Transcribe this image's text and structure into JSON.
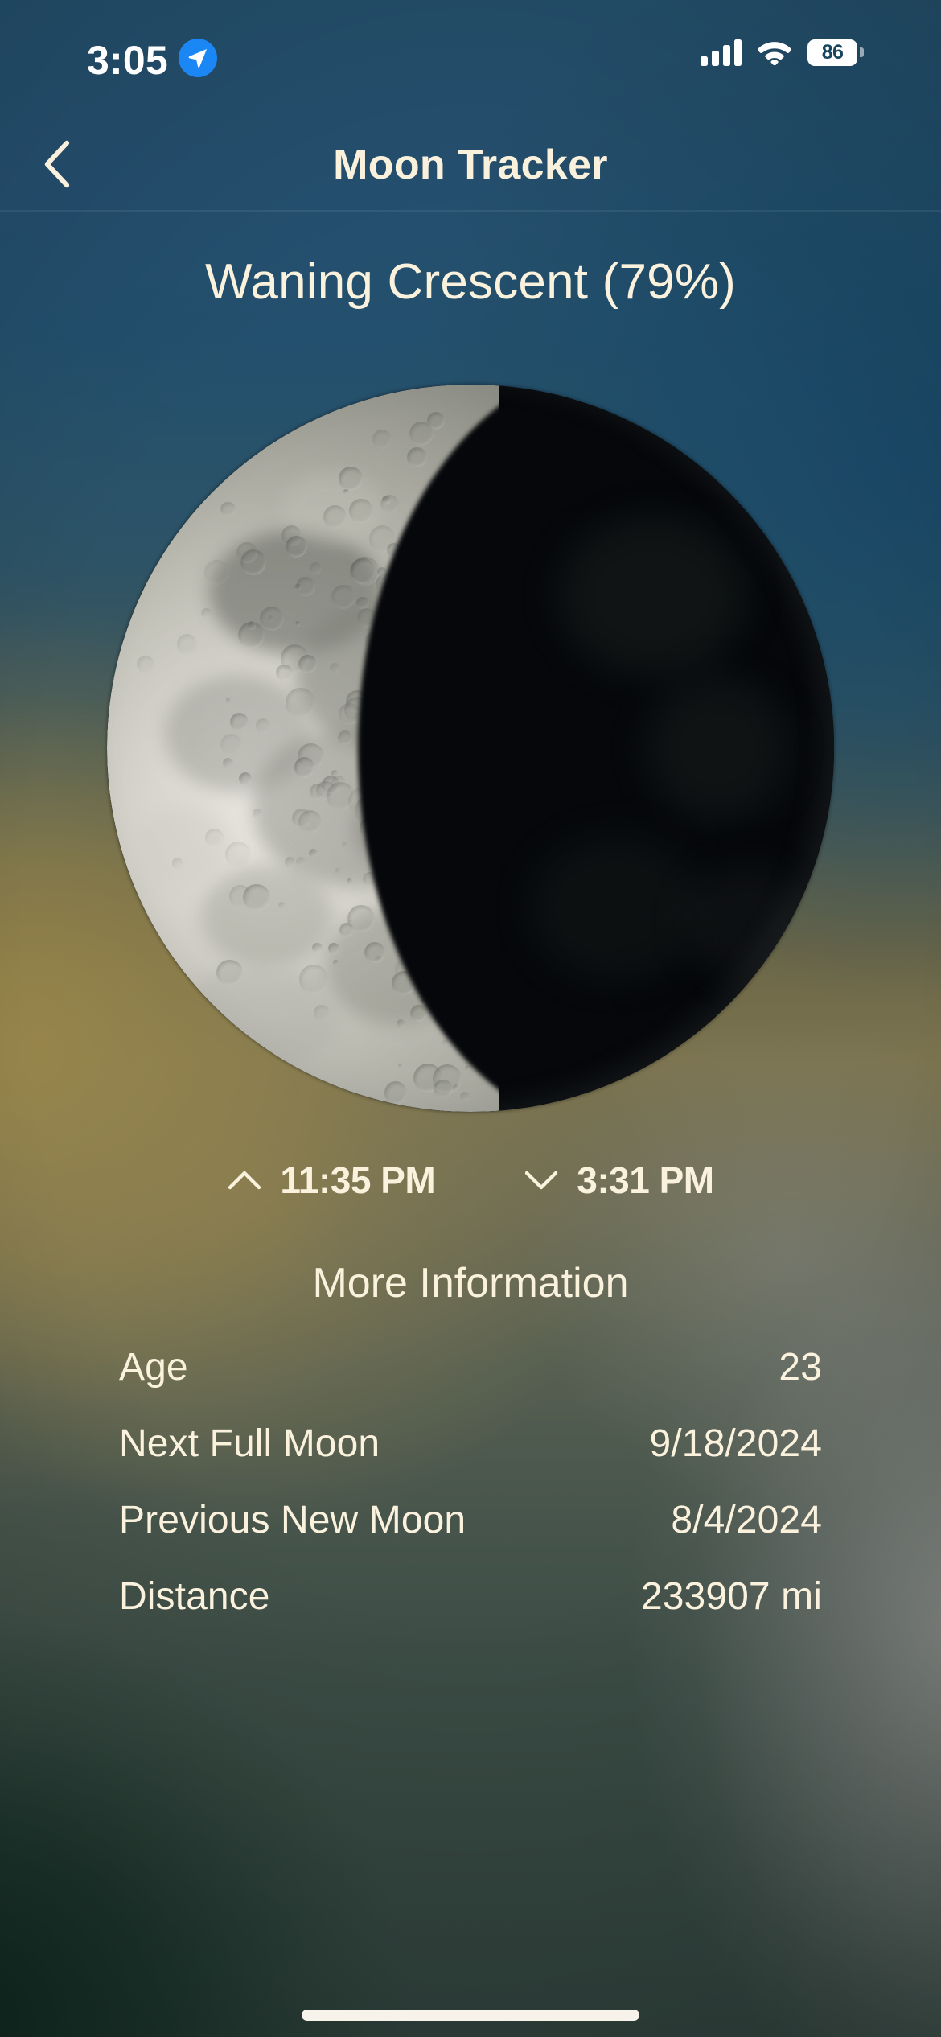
{
  "status_bar": {
    "time": "3:05",
    "location_icon": "location-arrow-icon",
    "signal_icon": "cellular-signal-icon",
    "wifi_icon": "wifi-icon",
    "battery_level": "86",
    "battery_icon": "battery-icon"
  },
  "nav_bar": {
    "back_icon": "chevron-left-icon",
    "title": "Moon Tracker"
  },
  "main": {
    "phase_title": "Waning Crescent (79%)",
    "moon_image_alt": "waning-crescent-moon",
    "moonrise": {
      "icon": "chevron-up-icon",
      "time": "11:35 PM"
    },
    "moonset": {
      "icon": "chevron-down-icon",
      "time": "3:31 PM"
    },
    "more_information_heading": "More Information",
    "info_rows": [
      {
        "label": "Age",
        "value": "23"
      },
      {
        "label": "Next Full Moon",
        "value": "9/18/2024"
      },
      {
        "label": "Previous New Moon",
        "value": "8/4/2024"
      },
      {
        "label": "Distance",
        "value": "233907 mi"
      }
    ]
  },
  "colors": {
    "text_cream": "#fbf2dd",
    "status_white": "#ffffff",
    "location_badge_blue": "#1a87f5",
    "top_background_blue": "#24506d",
    "moon_lit": "#d8d6ce",
    "moon_shadow": "#05070a"
  },
  "moon_phase_data": {
    "phase_name": "Waning Crescent",
    "illumination_percent": 79,
    "lit_side": "left",
    "age_days": 23,
    "distance_mi": 233907
  }
}
